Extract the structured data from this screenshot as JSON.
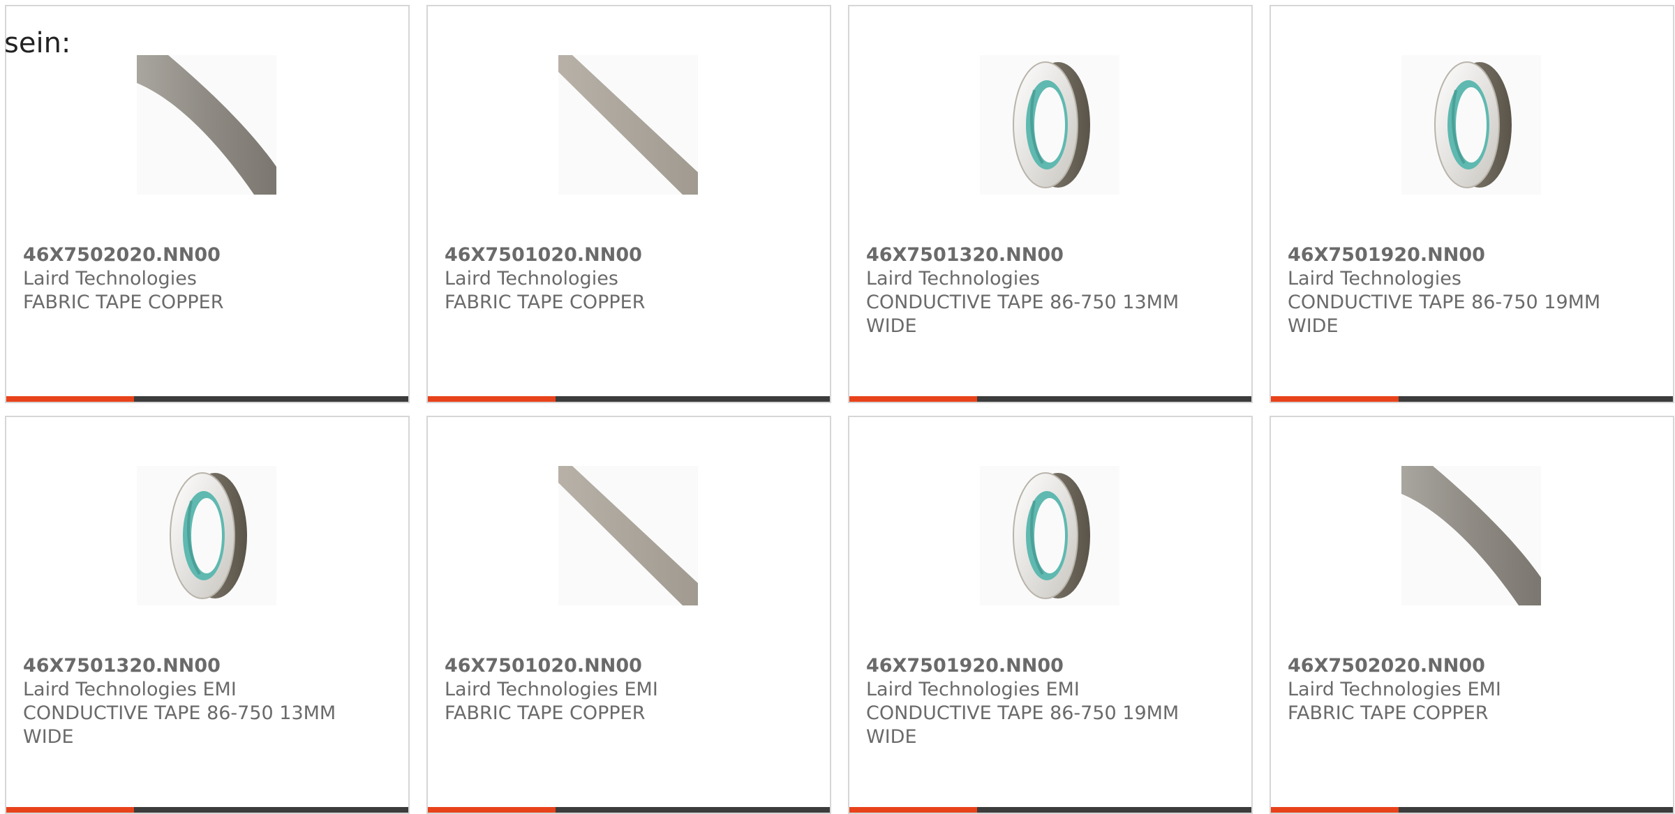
{
  "intro_text": "sein:",
  "colors": {
    "accent": "#e8421a",
    "bar": "#3c3c3c",
    "text": "#6a6a6a",
    "border": "#d6d6d6"
  },
  "products": [
    {
      "part_number": "46X7502020.NN00",
      "manufacturer": "Laird Technologies",
      "description": "FABRIC TAPE COPPER",
      "image": "tape-strip-wide"
    },
    {
      "part_number": "46X7501020.NN00",
      "manufacturer": "Laird Technologies",
      "description": "FABRIC TAPE COPPER",
      "image": "tape-strip-narrow"
    },
    {
      "part_number": "46X7501320.NN00",
      "manufacturer": "Laird Technologies",
      "description": "CONDUCTIVE TAPE 86-750 13MM WIDE",
      "image": "tape-roll"
    },
    {
      "part_number": "46X7501920.NN00",
      "manufacturer": "Laird Technologies",
      "description": "CONDUCTIVE TAPE 86-750 19MM WIDE",
      "image": "tape-roll"
    },
    {
      "part_number": "46X7501320.NN00",
      "manufacturer": "Laird Technologies EMI",
      "description": "CONDUCTIVE TAPE 86-750 13MM WIDE",
      "image": "tape-roll"
    },
    {
      "part_number": "46X7501020.NN00",
      "manufacturer": "Laird Technologies EMI",
      "description": "FABRIC TAPE COPPER",
      "image": "tape-strip-narrow"
    },
    {
      "part_number": "46X7501920.NN00",
      "manufacturer": "Laird Technologies EMI",
      "description": "CONDUCTIVE TAPE 86-750 19MM WIDE",
      "image": "tape-roll"
    },
    {
      "part_number": "46X7502020.NN00",
      "manufacturer": "Laird Technologies EMI",
      "description": "FABRIC TAPE COPPER",
      "image": "tape-strip-wide"
    }
  ]
}
